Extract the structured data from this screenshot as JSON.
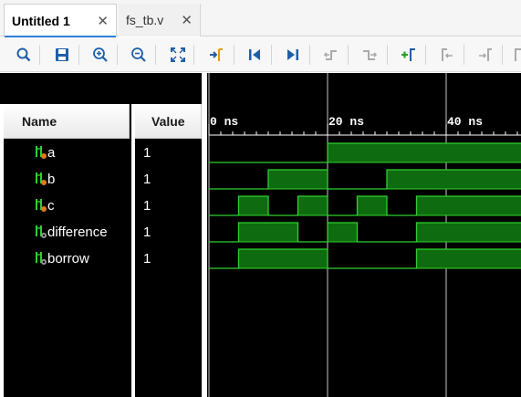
{
  "tabs": [
    {
      "label": "Untitled 1",
      "active": true
    },
    {
      "label": "fs_tb.v",
      "active": false
    }
  ],
  "toolbar": {
    "buttons": [
      {
        "name": "search-icon"
      },
      {
        "name": "save-icon"
      },
      {
        "name": "zoom-in-icon"
      },
      {
        "name": "zoom-out-icon"
      },
      {
        "name": "zoom-fit-icon"
      },
      {
        "name": "go-to-cursor-icon"
      },
      {
        "name": "go-to-time-zero-icon"
      },
      {
        "name": "go-to-last-time-icon"
      },
      {
        "name": "previous-transition-icon"
      },
      {
        "name": "next-transition-icon"
      },
      {
        "name": "add-marker-icon"
      },
      {
        "name": "previous-marker-icon"
      },
      {
        "name": "next-marker-icon"
      }
    ]
  },
  "columns": {
    "name": "Name",
    "value": "Value"
  },
  "time_axis": {
    "labels": [
      "0 ns",
      "20 ns",
      "40 ns"
    ],
    "unit": "ns",
    "time_step_ns": 5
  },
  "signals": [
    {
      "name": "a",
      "value": "1",
      "kind": "input",
      "levels": [
        0,
        0,
        0,
        0,
        1,
        1,
        1,
        1,
        1,
        1,
        1
      ]
    },
    {
      "name": "b",
      "value": "1",
      "kind": "input",
      "levels": [
        0,
        0,
        1,
        1,
        0,
        0,
        1,
        1,
        1,
        1,
        1
      ]
    },
    {
      "name": "c",
      "value": "1",
      "kind": "input",
      "levels": [
        0,
        1,
        0,
        1,
        0,
        1,
        0,
        1,
        1,
        1,
        1
      ]
    },
    {
      "name": "difference",
      "value": "1",
      "kind": "output",
      "levels": [
        0,
        1,
        1,
        0,
        1,
        0,
        0,
        1,
        1,
        1,
        1
      ]
    },
    {
      "name": "borrow",
      "value": "1",
      "kind": "output",
      "levels": [
        0,
        1,
        1,
        1,
        0,
        0,
        0,
        1,
        1,
        1,
        1
      ]
    }
  ],
  "colors": {
    "wave": "#2fd02f",
    "wave_fill": "#0f6b0f",
    "background": "#000000",
    "grid": "#c8c8c8",
    "accent": "#2f7fd8",
    "input_icon": "#e07a1f",
    "output_icon": "#9a9a9a"
  }
}
